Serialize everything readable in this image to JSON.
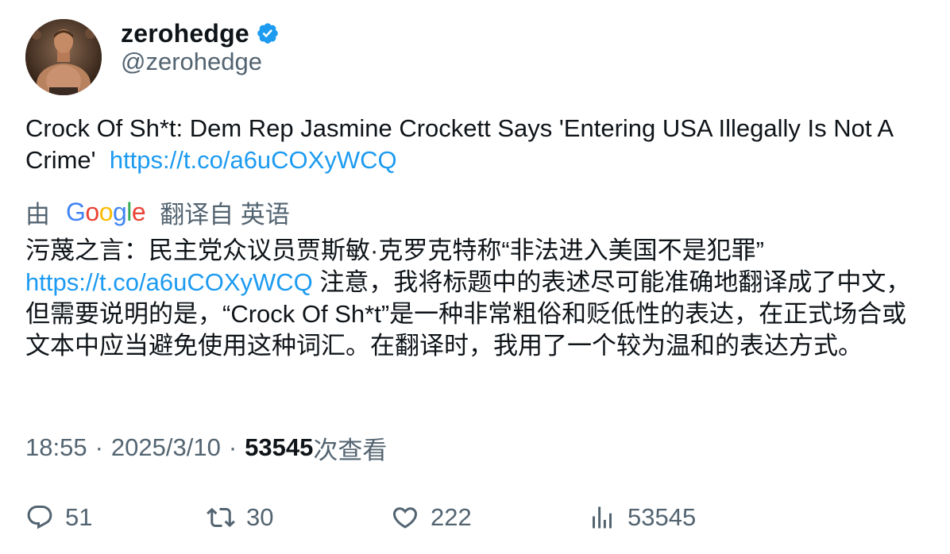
{
  "user": {
    "display_name": "zerohedge",
    "handle": "@zerohedge",
    "verified": true,
    "verified_color": "#1d9bf0"
  },
  "tweet": {
    "text": "Crock Of Sh*t: Dem Rep Jasmine Crockett Says 'Entering USA Illegally Is Not A Crime'",
    "link": "https://t.co/a6uCOXyWCQ"
  },
  "translation": {
    "by_label": "由",
    "google_letters": [
      "G",
      "o",
      "o",
      "g",
      "l",
      "e"
    ],
    "from_label": "翻译自 英语",
    "text_line1": "污蔑之言：民主党众议员贾斯敏·克罗克特称“非法进入美国不是犯罪”",
    "link": "https://t.co/a6uCOXyWCQ",
    "text_rest": "注意，我将标题中的表述尽可能准确地翻译成了中文，但需要说明的是，“Crock Of Sh*t”是一种非常粗俗和贬低性的表达，在正式场合或文本中应当避免使用这种词汇。在翻译时，我用了一个较为温和的表达方式。"
  },
  "meta": {
    "time": "18:55",
    "dot": "·",
    "date": "2025/3/10",
    "views_count": "53545",
    "views_label": "次查看"
  },
  "actions": {
    "replies": "51",
    "retweets": "30",
    "likes": "222",
    "views": "53545"
  },
  "colors": {
    "text": "#0f1419",
    "secondary": "#536471",
    "link": "#1d9bf0"
  },
  "icons": {
    "reply": "speech-bubble-icon",
    "retweet": "retweet-arrows-icon",
    "like": "heart-icon",
    "views": "bar-chart-icon",
    "verified": "verified-badge-icon"
  }
}
